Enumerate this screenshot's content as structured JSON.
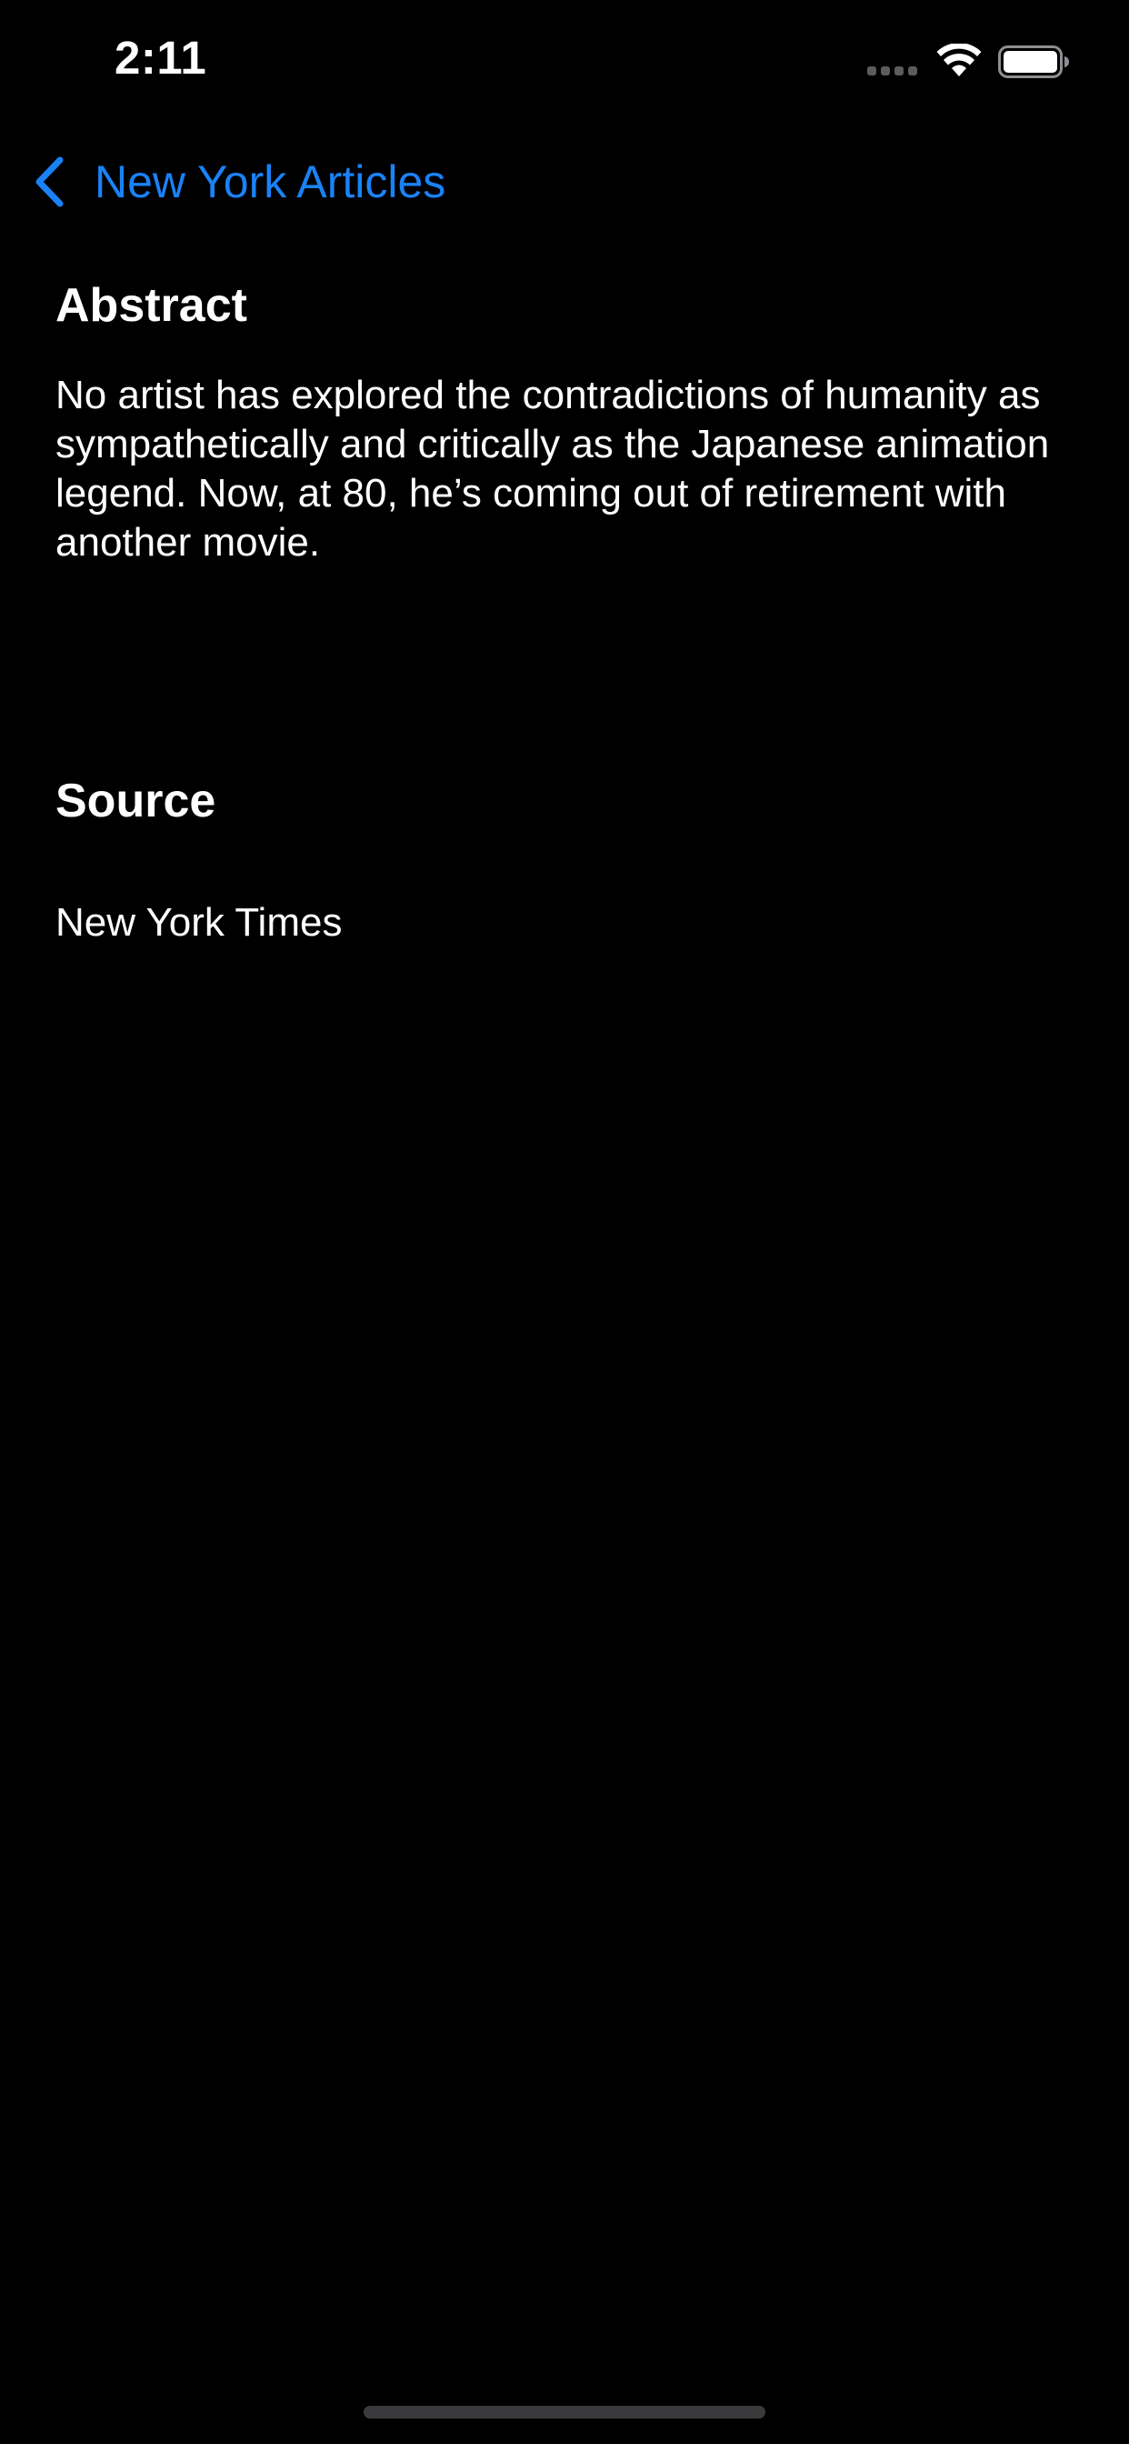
{
  "status_bar": {
    "time": "2:11"
  },
  "nav": {
    "back_label": "New York Articles",
    "back_icon": "chevron-left-icon",
    "accent_color": "#1a82f7"
  },
  "abstract": {
    "heading": "Abstract",
    "text": "No artist has explored the contradictions of humanity as sympathetically and critically as the Japanese animation legend. Now, at 80, he’s coming out of retirement with another movie."
  },
  "source": {
    "heading": "Source",
    "value": "New York Times"
  },
  "theme": {
    "background": "#000000",
    "text": "#ffffff"
  }
}
